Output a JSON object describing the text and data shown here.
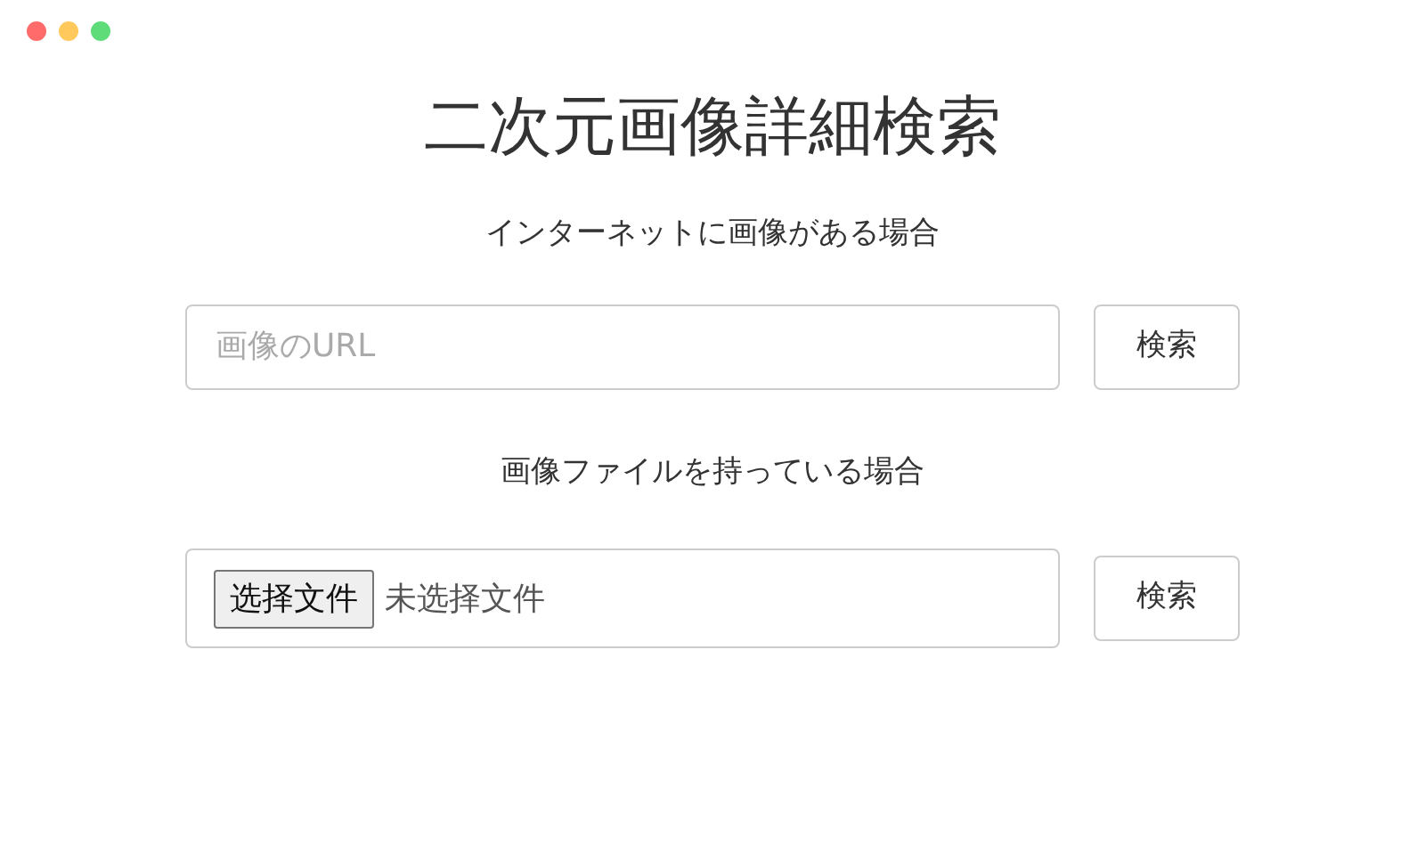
{
  "title": "二次元画像詳細検索",
  "sections": [
    {
      "kind": "url",
      "heading": "インターネットに画像がある場合",
      "placeholder": "画像のURL",
      "button": "検索"
    },
    {
      "kind": "file",
      "heading": "画像ファイルを持っている場合",
      "file_button": "选择文件",
      "file_status": "未选择文件",
      "button": "検索"
    }
  ]
}
